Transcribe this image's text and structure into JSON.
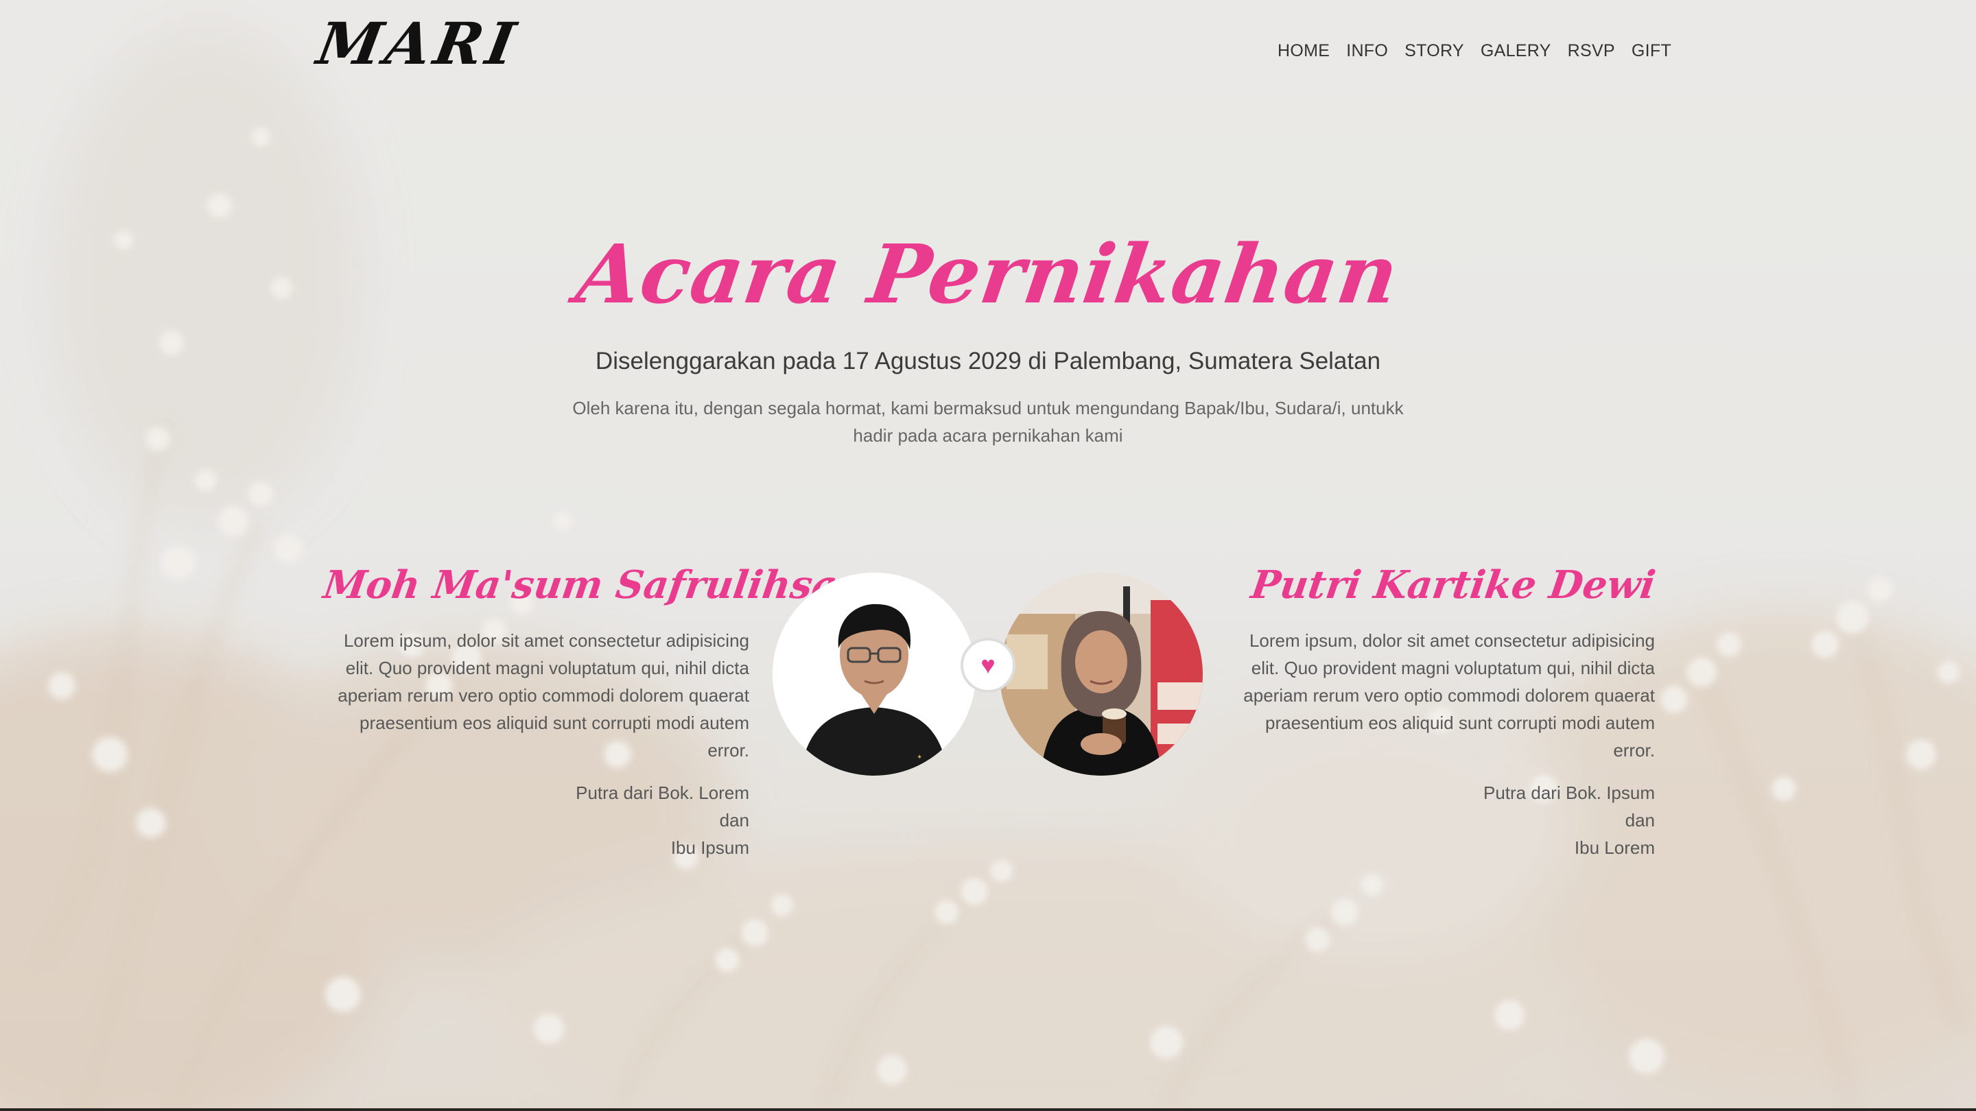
{
  "brand": "MARI",
  "nav": {
    "home": "HOME",
    "info": "INFO",
    "story": "STORY",
    "galery": "GALERY",
    "rsvp": "RSVP",
    "gift": "GIFT"
  },
  "hero": {
    "title": "Acara Pernikahan",
    "subtitle": "Diselenggarakan pada 17 Agustus 2029 di Palembang, Sumatera Selatan",
    "text": "Oleh karena itu, dengan segala hormat, kami bermaksud untuk mengundang Bapak/Ibu, Sudara/i, untukk hadir pada acara pernikahan kami"
  },
  "groom": {
    "name": "Moh Ma'sum Safrulihsan",
    "bio": "Lorem ipsum, dolor sit amet consectetur adipisicing elit. Quo provident magni voluptatum qui, nihil dicta aperiam rerum vero optio commodi dolorem quaerat praesentium eos aliquid sunt corrupti modi autem error.",
    "parent_1": "Putra dari Bok. Lorem",
    "conjunction": "dan",
    "parent_2": "Ibu Ipsum"
  },
  "bride": {
    "name": "Putri Kartike Dewi",
    "bio": "Lorem ipsum, dolor sit amet consectetur adipisicing elit. Quo provident magni voluptatum qui, nihil dicta aperiam rerum vero optio commodi dolorem quaerat praesentium eos aliquid sunt corrupti modi autem error.",
    "parent_1": "Putra dari Bok. Ipsum",
    "conjunction": "dan",
    "parent_2": "Ibu Lorem"
  },
  "heart_icon": "heart-icon",
  "colors": {
    "accent": "#ea3c8f",
    "background": "#e8e7e5",
    "text": "#555555"
  }
}
